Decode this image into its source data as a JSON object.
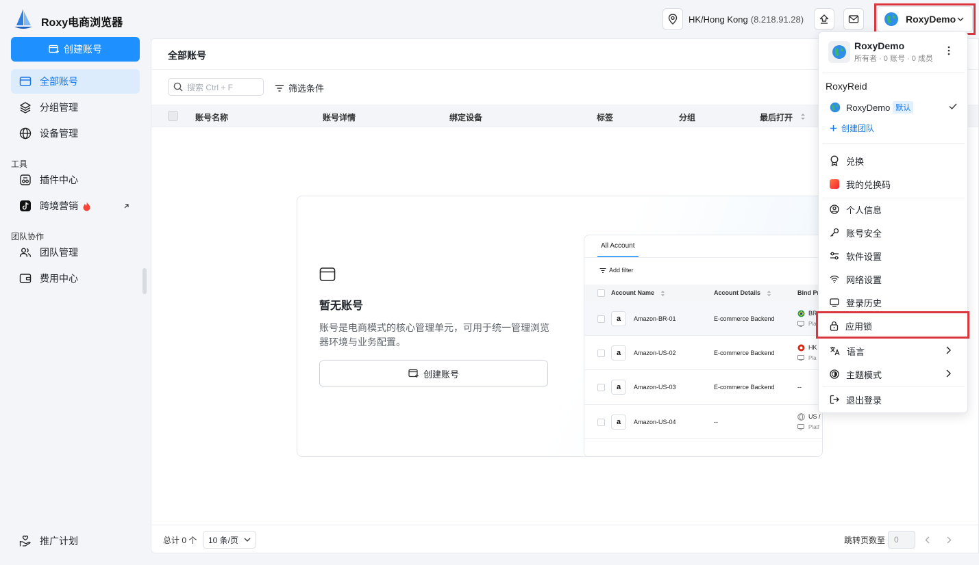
{
  "app": {
    "title": "Roxy电商浏览器"
  },
  "topbar": {
    "location": "HK/Hong Kong",
    "ip": "(8.218.91.28)",
    "user": "RoxyDemo"
  },
  "sidebar": {
    "create_label": "创建账号",
    "items": [
      {
        "label": "全部账号",
        "icon": "card-icon"
      },
      {
        "label": "分组管理",
        "icon": "layers-icon"
      },
      {
        "label": "设备管理",
        "icon": "globe-icon"
      }
    ],
    "section_tools": "工具",
    "tools": [
      {
        "label": "插件中心",
        "icon": "puzzle-icon"
      },
      {
        "label": "跨境营销",
        "icon": "tiktok-icon"
      }
    ],
    "section_team": "团队协作",
    "team": [
      {
        "label": "团队管理",
        "icon": "users-icon"
      },
      {
        "label": "费用中心",
        "icon": "wallet-icon"
      }
    ],
    "promo": "推广计划"
  },
  "main": {
    "title": "全部账号",
    "search_placeholder": "搜索 Ctrl + F",
    "filter_label": "筛选条件",
    "columns": [
      "账号名称",
      "账号详情",
      "绑定设备",
      "标签",
      "分组",
      "最后打开"
    ],
    "empty_title": "暂无账号",
    "empty_desc": "账号是电商模式的核心管理单元，可用于统一管理浏览器环境与业务配置。",
    "empty_btn": "创建账号",
    "preview": {
      "tab": "All Account",
      "add_filter": "Add filter",
      "columns": [
        "Account Name",
        "Account Details",
        "Bind Pr"
      ],
      "rows": [
        {
          "name": "Amazon-BR-01",
          "details": "E-commerce Backend",
          "bind": "BR",
          "sub": "Pla"
        },
        {
          "name": "Amazon-US-02",
          "details": "E-commerce Backend",
          "bind": "HK",
          "sub": "Pla"
        },
        {
          "name": "Amazon-US-03",
          "details": "E-commerce Backend",
          "bind": "--",
          "sub": ""
        },
        {
          "name": "Amazon-US-04",
          "details": "--",
          "bind": "US /",
          "sub": "Platf"
        }
      ]
    },
    "footer": {
      "total": "总计 0 个",
      "page_size": "10 条/页",
      "jump_label": "跳转页数至",
      "jump_value": "0"
    }
  },
  "dropdown": {
    "name": "RoxyDemo",
    "sub": "所有者 · 0 账号 · 0 成员",
    "team_owner": "RoxyReid",
    "workspace": "RoxyDemo",
    "default_badge": "默认",
    "create_team": "创建团队",
    "items": [
      {
        "label": "兑换",
        "icon": "award-icon"
      },
      {
        "label": "我的兑换码",
        "icon": "redeem-code-icon"
      },
      {
        "label": "个人信息",
        "icon": "user-circle-icon"
      },
      {
        "label": "账号安全",
        "icon": "key-icon"
      },
      {
        "label": "软件设置",
        "icon": "sliders-icon"
      },
      {
        "label": "网络设置",
        "icon": "wifi-icon"
      },
      {
        "label": "登录历史",
        "icon": "monitor-icon"
      },
      {
        "label": "应用锁",
        "icon": "lock-icon"
      },
      {
        "label": "语言",
        "icon": "translate-icon"
      },
      {
        "label": "主题模式",
        "icon": "theme-icon"
      },
      {
        "label": "退出登录",
        "icon": "logout-icon"
      }
    ]
  },
  "colors": {
    "accent": "#1e90ff",
    "highlight": "#d9363e"
  }
}
